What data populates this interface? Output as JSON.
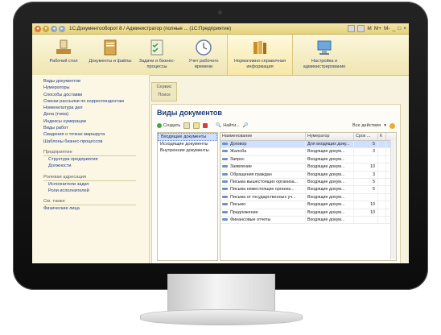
{
  "window": {
    "title": "1С:Документооборот 8 / Администратор (полные ... (1С:Предприятие)",
    "right_labels": [
      "M",
      "M+",
      "M-"
    ]
  },
  "sections": [
    {
      "label": "Рабочий стол"
    },
    {
      "label": "Документы и файлы"
    },
    {
      "label": "Задачи и бизнес-процессы"
    },
    {
      "label": "Учет рабочего времени"
    },
    {
      "label": "Нормативно-справочная информация"
    },
    {
      "label": "Настройка и администрирование"
    }
  ],
  "sidebar": {
    "links": [
      "Виды документов",
      "Нумераторы",
      "Способы доставки",
      "Списки рассылки по корреспондентам",
      "Номенклатура дел",
      "Дела (тома)",
      "Индексы нумерации",
      "Виды работ",
      "Сведения о точках маршрута",
      "Шаблоны бизнес-процессов"
    ],
    "group1": {
      "title": "Предприятие",
      "items": [
        "Структура предприятия",
        "Должности"
      ]
    },
    "group2": {
      "title": "Ролевая адресация",
      "items": [
        "Исполнители задач",
        "Роли исполнителей"
      ]
    },
    "group3": {
      "title": "См. также",
      "items": [
        "Физические лица"
      ]
    }
  },
  "service": {
    "label": "Сервис",
    "search": "Поиск"
  },
  "doc": {
    "title": "Виды документов",
    "create": "Создать",
    "find": "Найти...",
    "all_actions": "Все действия"
  },
  "left_list": [
    "Входящие документы",
    "Исходящие документы",
    "Внутренние документы"
  ],
  "table": {
    "headers": [
      "Наименование",
      "Нумератор",
      "Срок ...",
      "К"
    ],
    "rows": [
      {
        "name": "Договор",
        "numerator": "Для входящих доку...",
        "term": "5"
      },
      {
        "name": "Жалоба",
        "numerator": "Входящие докум...",
        "term": "3"
      },
      {
        "name": "Запрос",
        "numerator": "Входящие докум...",
        "term": ""
      },
      {
        "name": "Заявление",
        "numerator": "Входящие докум...",
        "term": "10"
      },
      {
        "name": "Обращения граждан",
        "numerator": "Входящие докум...",
        "term": "3"
      },
      {
        "name": "Письма вышестоящих организа...",
        "numerator": "Входящие докум...",
        "term": "5"
      },
      {
        "name": "Письма нижестоящих организ...",
        "numerator": "Входящие докум...",
        "term": "5"
      },
      {
        "name": "Письма от государственных уч...",
        "numerator": "Входящие докум...",
        "term": ""
      },
      {
        "name": "Письмо",
        "numerator": "Входящие докум...",
        "term": "10"
      },
      {
        "name": "Предложение",
        "numerator": "Входящие докум...",
        "term": "10"
      },
      {
        "name": "Финансовые отчеты",
        "numerator": "Входящие докум...",
        "term": ""
      }
    ]
  }
}
